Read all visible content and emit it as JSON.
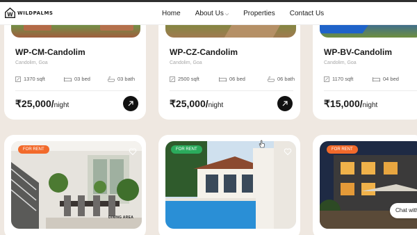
{
  "brand": {
    "logo_text": "WILDPALMS"
  },
  "nav": {
    "items": [
      "Home",
      "About Us",
      "Properties",
      "Contact Us"
    ]
  },
  "properties_top": [
    {
      "title": "WP-CM-Candolim",
      "location": "Candolim, Goa",
      "area": "1370 sqft",
      "beds": "03 bed",
      "baths": "03 bath",
      "price": "₹25,000/",
      "per": "night"
    },
    {
      "title": "WP-CZ-Candolim",
      "location": "Candolim, Goa",
      "area": "2500 sqft",
      "beds": "06 bed",
      "baths": "06 bath",
      "price": "₹25,000/",
      "per": "night"
    },
    {
      "title": "WP-BV-Candolim",
      "location": "Candolim, Goa",
      "area": "1170 sqft",
      "beds": "04 bed",
      "baths": "",
      "price": "₹15,000/",
      "per": "night"
    }
  ],
  "properties_bottom": [
    {
      "badge": "FOR RENT",
      "badge_color": "#f26a2b",
      "caption": "DINING AREA"
    },
    {
      "badge": "FOR RENT",
      "badge_color": "#2bab5c",
      "caption": ""
    },
    {
      "badge": "FOR RENT",
      "badge_color": "#f26a2b",
      "caption": ""
    }
  ],
  "chat": {
    "label": "Chat with"
  },
  "colors": {
    "page_bg": "#efe8e1",
    "accent_orange": "#f26a2b",
    "accent_green": "#2bab5c"
  }
}
